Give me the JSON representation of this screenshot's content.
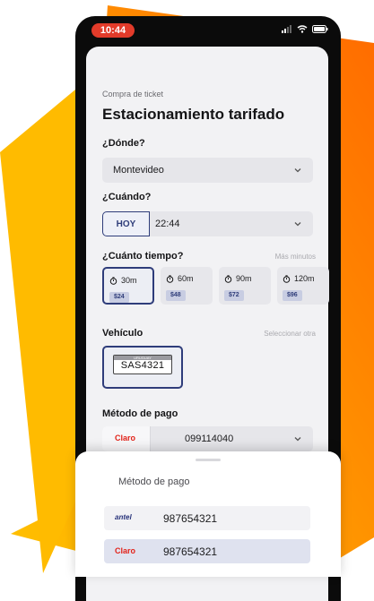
{
  "status_bar": {
    "time": "10:44"
  },
  "header": {
    "overline": "Compra de ticket",
    "title": "Estacionamiento tarifado"
  },
  "where": {
    "label": "¿Dónde?",
    "value": "Montevideo"
  },
  "when": {
    "label": "¿Cuándo?",
    "today_label": "HOY",
    "time": "22:44"
  },
  "duration": {
    "label": "¿Cuánto tiempo?",
    "more_link": "Más minutos",
    "options": [
      {
        "time": "30m",
        "price": "$24",
        "selected": true
      },
      {
        "time": "60m",
        "price": "$48",
        "selected": false
      },
      {
        "time": "90m",
        "price": "$72",
        "selected": false
      },
      {
        "time": "120m",
        "price": "$96",
        "selected": false
      }
    ]
  },
  "vehicle": {
    "label": "Vehículo",
    "other_link": "Seleccionar otra",
    "plate_country": "URUGUAY",
    "plate": "SAS4321"
  },
  "payment": {
    "label": "Método de pago",
    "brand": "Claro",
    "number": "099114040"
  },
  "bottom_sheet": {
    "title": "Método de pago",
    "options": [
      {
        "brand": "antel",
        "number": "987654321",
        "selected": false
      },
      {
        "brand": "Claro",
        "number": "987654321",
        "selected": true
      }
    ]
  },
  "colors": {
    "accent": "#2f3d7a",
    "orange": "#ff6a00",
    "yellow": "#ffc400",
    "claro_red": "#e2231a"
  }
}
